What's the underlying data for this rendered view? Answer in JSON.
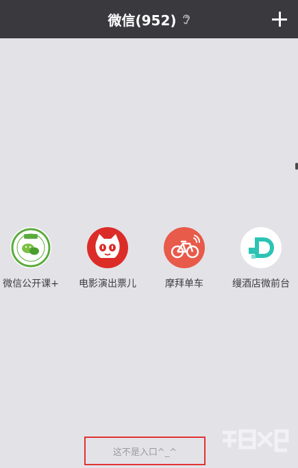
{
  "navbar": {
    "title": "微信(952)",
    "ear_icon": "earpiece-icon",
    "add_icon": "plus-icon"
  },
  "apps": [
    {
      "label": "微信公开课+",
      "icon": "wechat-open-class-icon",
      "color": "#ffffff"
    },
    {
      "label": "电影演出票儿",
      "icon": "maoyan-cat-icon",
      "color": "#dc2c28"
    },
    {
      "label": "摩拜单车",
      "icon": "mobike-bicycle-icon",
      "color": "#e85a4a"
    },
    {
      "label": "缦酒店微前台",
      "icon": "hotel-d-logo-icon",
      "color": "#ffffff"
    }
  ],
  "footer": {
    "entry_text": "这不是入口^_^"
  },
  "colors": {
    "navbar_bg": "#3a393e",
    "page_bg": "#e3e2e7",
    "highlight_box": "#e03232"
  }
}
